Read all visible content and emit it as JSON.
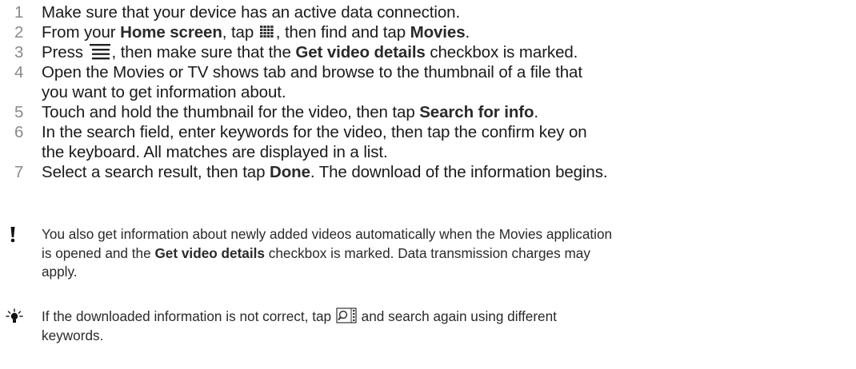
{
  "steps": [
    {
      "number": "1",
      "parts": [
        {
          "t": "Make sure that your device has an active data connection."
        }
      ]
    },
    {
      "number": "2",
      "parts": [
        {
          "t": "From your "
        },
        {
          "t": "Home screen",
          "b": true
        },
        {
          "t": ", tap "
        },
        {
          "icon": "apps-grid-icon"
        },
        {
          "t": ", then find and tap "
        },
        {
          "t": "Movies",
          "b": true
        },
        {
          "t": "."
        }
      ]
    },
    {
      "number": "3",
      "parts": [
        {
          "t": "Press "
        },
        {
          "icon": "menu-icon"
        },
        {
          "t": ", then make sure that the "
        },
        {
          "t": "Get video details",
          "b": true
        },
        {
          "t": " checkbox is marked."
        }
      ]
    },
    {
      "number": "4",
      "parts": [
        {
          "t": "Open the Movies or TV shows tab and browse to the thumbnail of a file that"
        }
      ],
      "cont": "you want to get information about."
    },
    {
      "number": "5",
      "parts": [
        {
          "t": "Touch and hold the thumbnail for the video, then tap "
        },
        {
          "t": "Search for info",
          "b": true
        },
        {
          "t": "."
        }
      ]
    },
    {
      "number": "6",
      "parts": [
        {
          "t": "In the search field, enter keywords for the video, then tap the confirm key on"
        }
      ],
      "cont": "the keyboard. All matches are displayed in a list."
    },
    {
      "number": "7",
      "parts": [
        {
          "t": "Select a search result, then tap "
        },
        {
          "t": "Done",
          "b": true
        },
        {
          "t": ". The download of the information begins."
        }
      ]
    }
  ],
  "note": {
    "icon": "exclamation-icon",
    "line1": "You also get information about newly added videos automatically when the Movies application",
    "line2_pre": "is opened and the ",
    "line2_bold": "Get video details",
    "line2_post": " checkbox is marked. Data transmission charges may",
    "line3": "apply."
  },
  "tip": {
    "icon": "lightbulb-icon",
    "line1_pre": "If the downloaded information is not correct, tap ",
    "line1_icon": "video-search-icon",
    "line1_post": " and search again using different",
    "line2": "keywords."
  }
}
